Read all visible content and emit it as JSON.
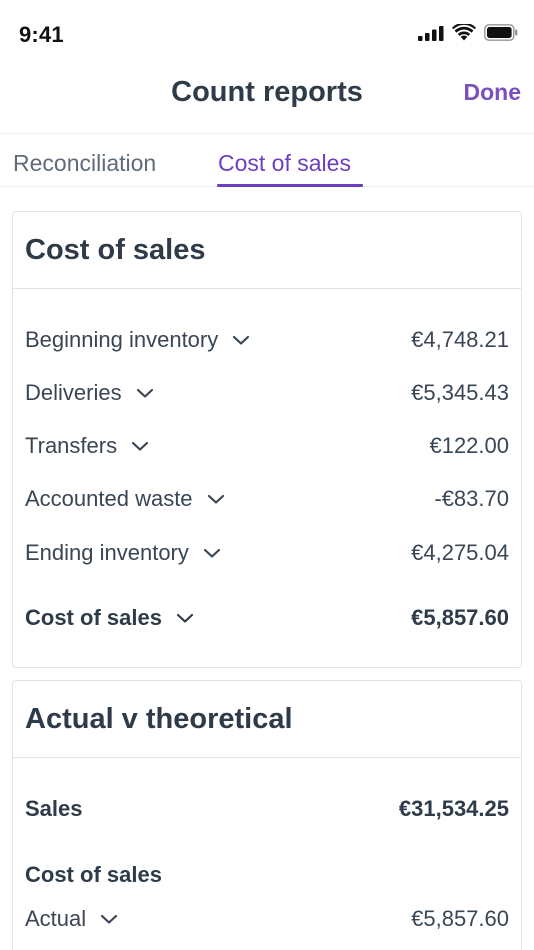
{
  "status_bar": {
    "time": "9:41"
  },
  "nav": {
    "title": "Count reports",
    "done_label": "Done"
  },
  "tabs": [
    {
      "label": "Reconciliation",
      "active": false
    },
    {
      "label": "Cost of sales",
      "active": true
    }
  ],
  "cost_of_sales_card": {
    "title": "Cost of sales",
    "rows": [
      {
        "label": "Beginning inventory",
        "value": "€4,748.21"
      },
      {
        "label": "Deliveries",
        "value": "€5,345.43"
      },
      {
        "label": "Transfers",
        "value": "€122.00"
      },
      {
        "label": "Accounted waste",
        "value": "-€83.70"
      },
      {
        "label": "Ending inventory",
        "value": "€4,275.04"
      }
    ],
    "total": {
      "label": "Cost of sales",
      "value": "€5,857.60"
    }
  },
  "actual_card": {
    "title": "Actual v theoretical",
    "sales": {
      "label": "Sales",
      "value": "€31,534.25"
    },
    "cost_section_label": "Cost of sales",
    "actual": {
      "label": "Actual",
      "value": "€5,857.60"
    }
  },
  "colors": {
    "accent": "#6c3fbf",
    "done": "#7a4fc0",
    "text": "#2f3b49",
    "border": "#dfe4ea"
  }
}
